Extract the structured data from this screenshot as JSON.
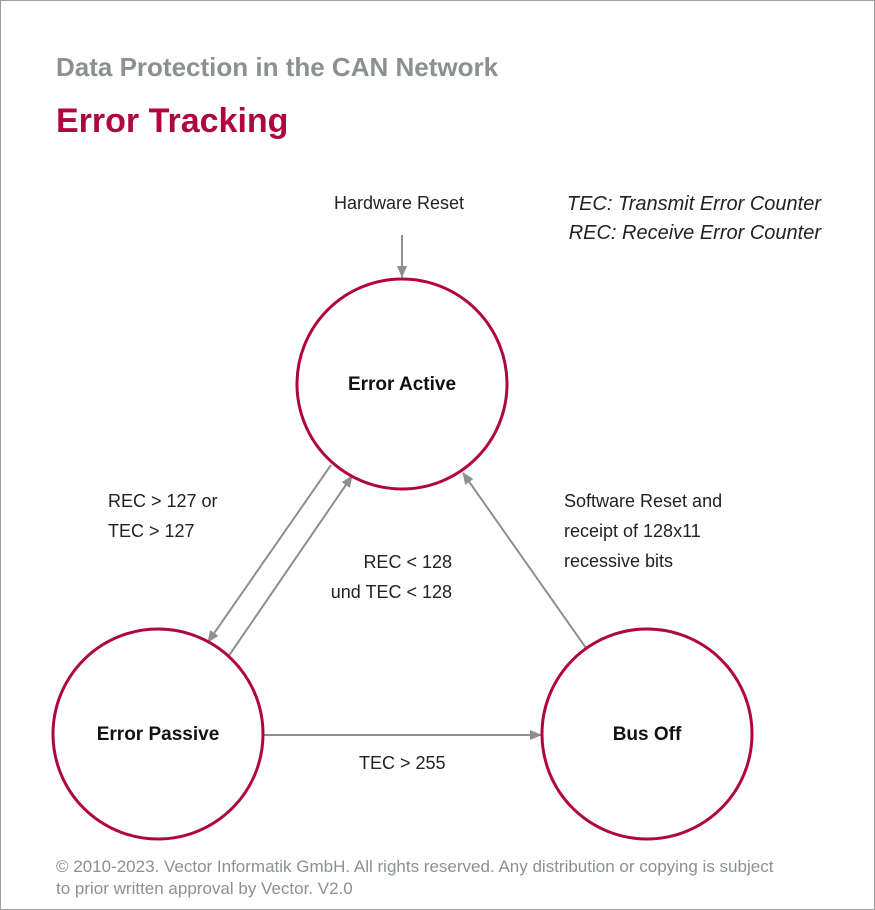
{
  "header": {
    "supertitle": "Data Protection in the CAN Network",
    "title": "Error Tracking"
  },
  "legend": {
    "tec": "TEC: Transmit Error Counter",
    "rec": "REC: Receive Error Counter"
  },
  "states": {
    "active": "Error Active",
    "passive": "Error Passive",
    "busoff": "Bus Off"
  },
  "transitions": {
    "hardware_reset": "Hardware Reset",
    "to_passive_line1": "REC > 127 or",
    "to_passive_line2": "TEC > 127",
    "to_active_line1": "REC < 128",
    "to_active_line2": "und TEC < 128",
    "software_reset_line1": "Software Reset and",
    "software_reset_line2": "receipt of 128x11",
    "software_reset_line3": "recessive bits",
    "to_busoff": "TEC > 255"
  },
  "footer": {
    "line1": "© 2010-2023. Vector Informatik GmbH. All rights reserved. Any distribution or copying is subject",
    "line2": "to prior written approval by Vector. V2.0"
  },
  "colors": {
    "accent": "#b0063e",
    "arrow": "#8c9092",
    "muted": "#8c9092"
  }
}
